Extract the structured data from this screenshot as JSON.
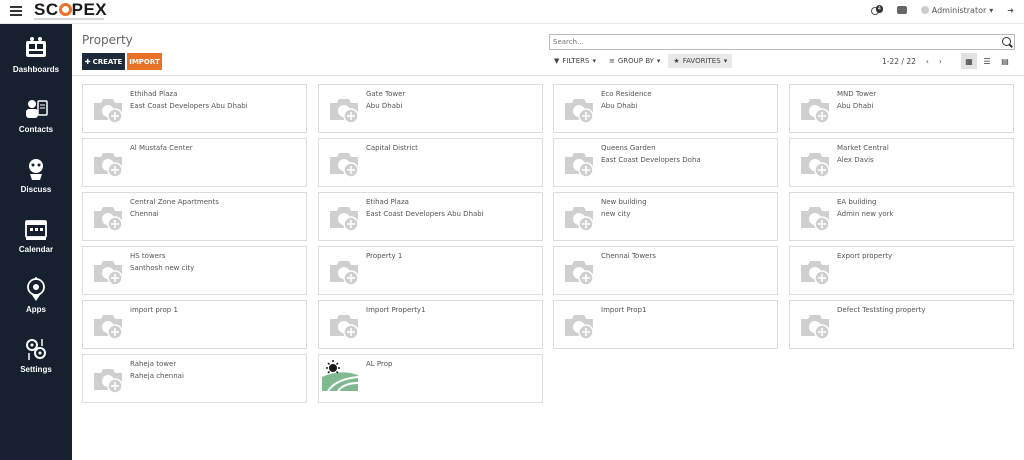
{
  "app": {
    "logo_text": "SCOPEX",
    "notifications_count": "4",
    "user_name": "Administrator"
  },
  "sidebar": {
    "items": [
      {
        "label": "Dashboards",
        "icon": "dashboard-icon"
      },
      {
        "label": "Contacts",
        "icon": "contacts-icon"
      },
      {
        "label": "Discuss",
        "icon": "discuss-icon"
      },
      {
        "label": "Calendar",
        "icon": "calendar-icon"
      },
      {
        "label": "Apps",
        "icon": "apps-icon"
      },
      {
        "label": "Settings",
        "icon": "settings-icon"
      }
    ]
  },
  "control": {
    "title": "Property",
    "create_label": "CREATE",
    "import_label": "IMPORT",
    "search_placeholder": "Search...",
    "filters_label": "FILTERS",
    "group_by_label": "GROUP BY",
    "favorites_label": "FAVORITES",
    "pager": "1-22 / 22"
  },
  "cards": [
    {
      "name": "Ethihad Plaza",
      "sub": "East Coast Developers Abu Dhabi"
    },
    {
      "name": "Gate Tower",
      "sub": "Abu Dhabi"
    },
    {
      "name": "Eco Residence",
      "sub": "Abu Dhabi"
    },
    {
      "name": "MND Tower",
      "sub": "Abu Dhabi"
    },
    {
      "name": "Al Mustafa Center",
      "sub": ""
    },
    {
      "name": "Capital District",
      "sub": ""
    },
    {
      "name": "Queens Garden",
      "sub": "East Coast Developers Doha"
    },
    {
      "name": "Market Central",
      "sub": "Alex Davis"
    },
    {
      "name": "Central Zone Apartments",
      "sub": "Chennai"
    },
    {
      "name": "Etihad Plaza",
      "sub": "East Coast Developers Abu Dhabi"
    },
    {
      "name": "New building",
      "sub": "new city"
    },
    {
      "name": "EA building",
      "sub": "Admin new york"
    },
    {
      "name": "HS towers",
      "sub": "Santhosh new city"
    },
    {
      "name": "Property 1",
      "sub": ""
    },
    {
      "name": "Chennai Towers",
      "sub": ""
    },
    {
      "name": "Export property",
      "sub": ""
    },
    {
      "name": "import prop 1",
      "sub": ""
    },
    {
      "name": "Import Property1",
      "sub": ""
    },
    {
      "name": "Import Prop1",
      "sub": ""
    },
    {
      "name": "Defect Teststing property",
      "sub": ""
    },
    {
      "name": "Raheja tower",
      "sub": "Raheja chennai"
    },
    {
      "name": "AL Prop",
      "sub": "",
      "image": "farm-logo"
    }
  ],
  "colors": {
    "sidebar_bg": "#17202f",
    "create_bg": "#1f2a3c",
    "import_bg": "#e8722a",
    "logo_accent": "#e8722a"
  }
}
